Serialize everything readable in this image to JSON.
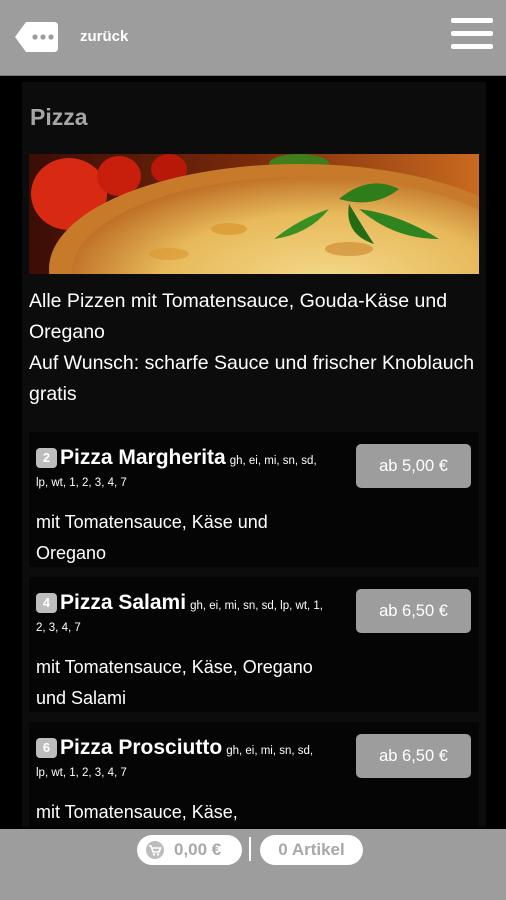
{
  "header": {
    "back_label": "zurück"
  },
  "category": {
    "title": "Pizza",
    "intro_lines": [
      "Alle Pizzen mit Tomatensauce, Gouda-Käse und Oregano",
      "Auf Wunsch: scharfe Sauce und frischer Knoblauch gratis"
    ]
  },
  "items": [
    {
      "number": "2",
      "name": "Pizza Margherita",
      "allergens": "gh, ei, mi, sn, sd, lp, wt, 1, 2, 3, 4, 7",
      "description": "mit Tomatensauce, Käse und Oregano",
      "price": "ab 5,00 €"
    },
    {
      "number": "4",
      "name": "Pizza Salami",
      "allergens": "gh, ei, mi, sn, sd, lp, wt, 1, 2, 3, 4, 7",
      "description": "mit Tomatensauce, Käse, Oregano und Salami",
      "price": "ab 6,50 €"
    },
    {
      "number": "6",
      "name": "Pizza Prosciutto",
      "allergens": "gh, ei, mi, sn, sd, lp, wt, 1, 2, 3, 4, 7",
      "description": "mit Tomatensauce, Käse,",
      "price": "ab 6,50 €"
    }
  ],
  "footer": {
    "cart_total": "0,00 €",
    "articles": "0 Artikel"
  },
  "icons": {
    "back": "chat-bubble-icon",
    "menu": "hamburger-menu-icon",
    "cart": "cart-icon"
  }
}
